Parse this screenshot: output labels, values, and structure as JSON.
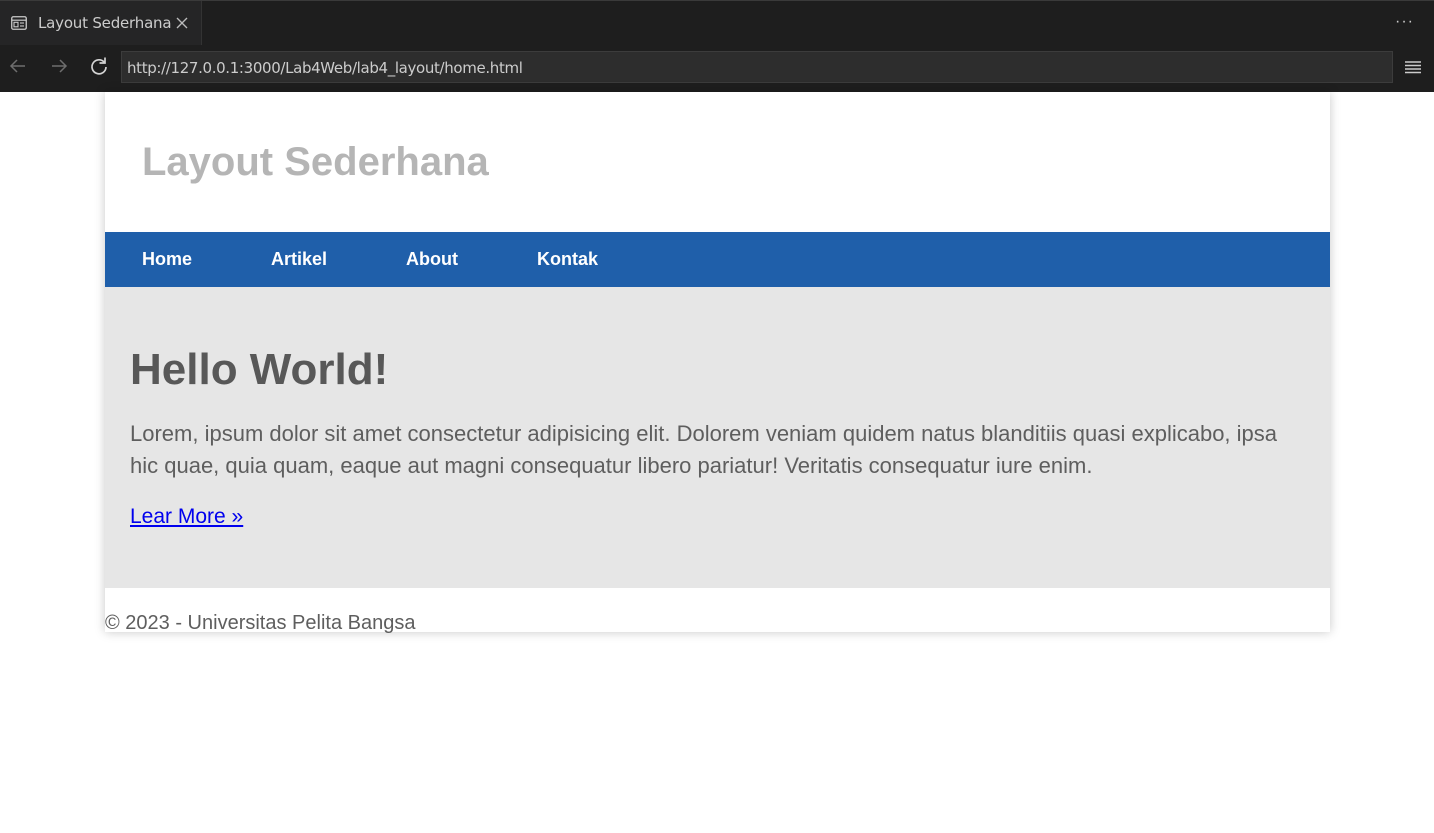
{
  "browser": {
    "tab_title": "Layout Sederhana",
    "more_label": "···",
    "url": "http://127.0.0.1:3000/Lab4Web/lab4_layout/home.html"
  },
  "page": {
    "header": {
      "title": "Layout Sederhana"
    },
    "nav": {
      "items": [
        {
          "label": "Home"
        },
        {
          "label": "Artikel"
        },
        {
          "label": "About"
        },
        {
          "label": "Kontak"
        }
      ]
    },
    "hero": {
      "title": "Hello World!",
      "text": "Lorem, ipsum dolor sit amet consectetur adipisicing elit. Dolorem veniam quidem natus blanditiis quasi explicabo, ipsa hic quae, quia quam, eaque aut magni consequatur libero pariatur! Veritatis consequatur iure enim.",
      "link_label": "Lear More »"
    },
    "footer": {
      "text": "© 2023 - Universitas Pelita Bangsa"
    }
  },
  "colors": {
    "nav_background": "#1f5faa",
    "hero_background": "#e6e6e6",
    "header_title": "#b5b5b5",
    "link": "#0000ee"
  }
}
